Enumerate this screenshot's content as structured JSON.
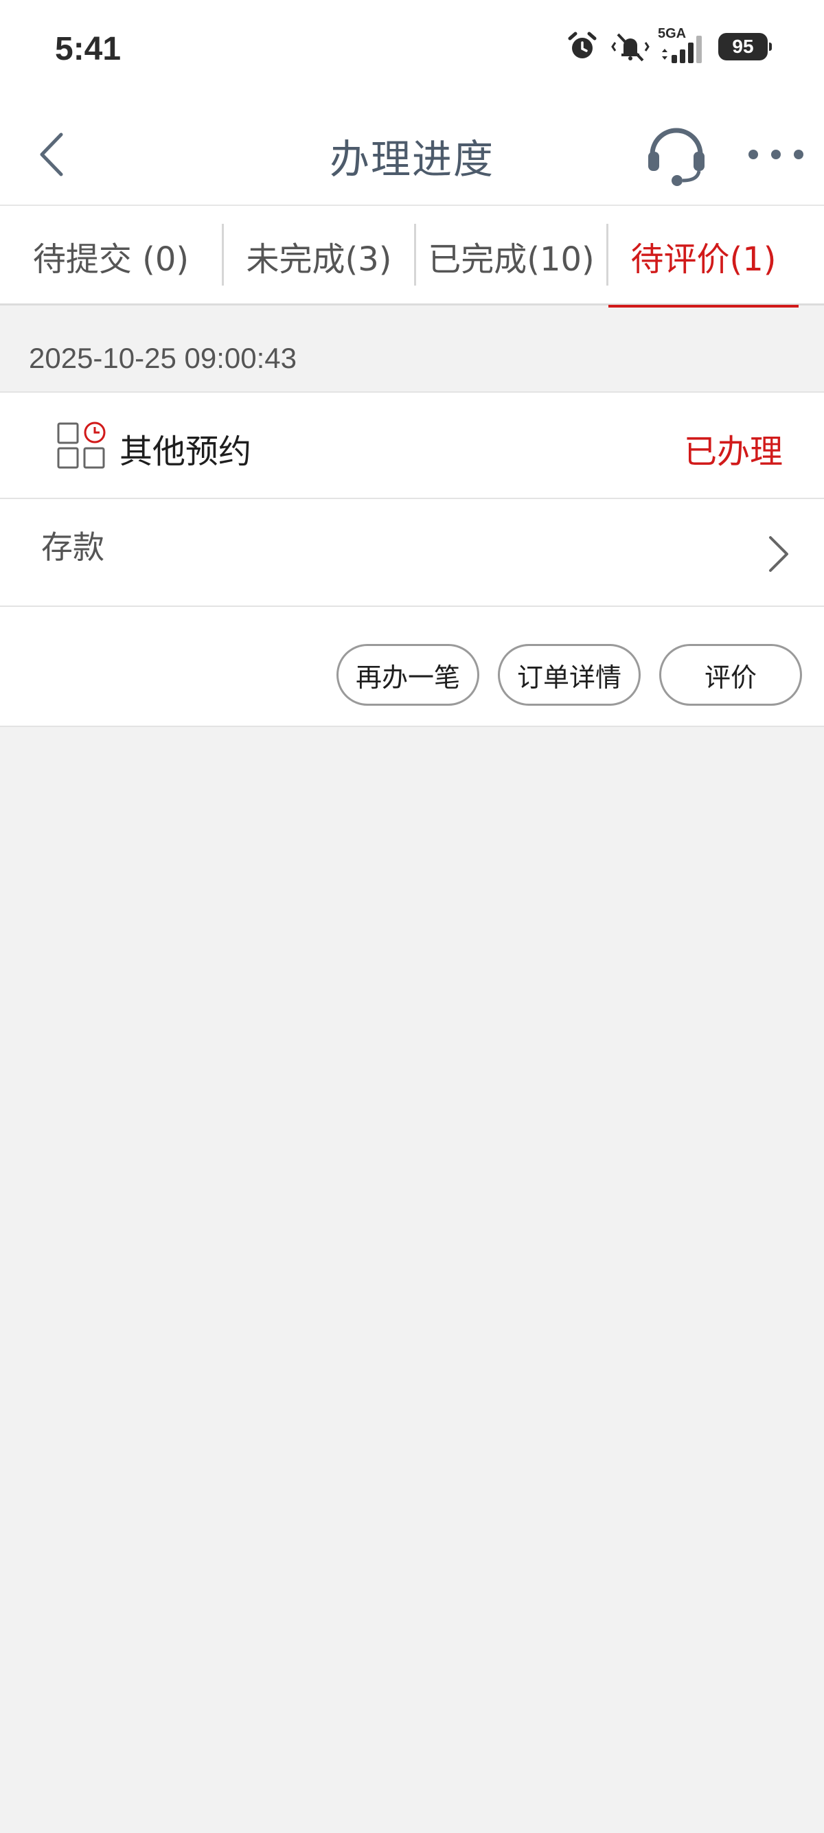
{
  "status_bar": {
    "time": "5:41",
    "network": "5GA",
    "battery": "95",
    "icons": [
      "alarm-icon",
      "mute-vibrate-icon",
      "signal-icon",
      "battery-icon"
    ]
  },
  "nav": {
    "title": "办理进度",
    "icons": [
      "back-icon",
      "headset-icon",
      "more-icon"
    ]
  },
  "tabs": [
    {
      "label": "待提交 (0)",
      "active": false
    },
    {
      "label": "未完成(3)",
      "active": false
    },
    {
      "label": "已完成(10)",
      "active": false
    },
    {
      "label": "待评价(1)",
      "active": true
    }
  ],
  "order": {
    "datetime": "2025-10-25 09:00:43",
    "service_type": "其他预约",
    "status": "已办理",
    "item": "存款",
    "actions": {
      "redo": "再办一笔",
      "details": "订单详情",
      "rate": "评价"
    }
  },
  "colors": {
    "accent": "#d11a1a",
    "background": "#f2f2f2",
    "title": "#4d5b6b"
  }
}
